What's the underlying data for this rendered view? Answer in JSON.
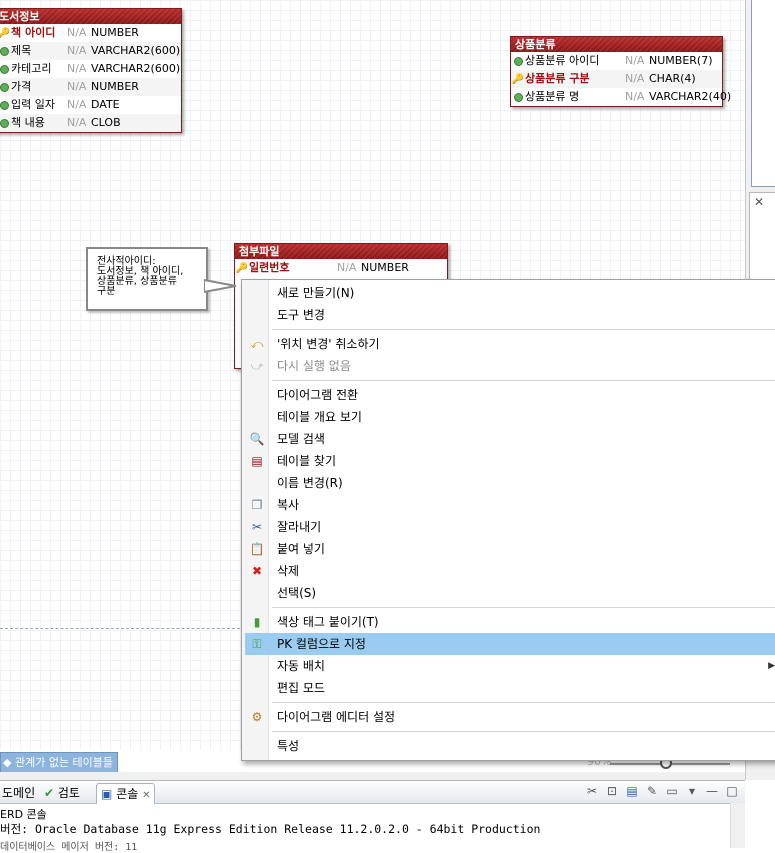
{
  "entities": {
    "book": {
      "title": "도서정보",
      "rows": [
        {
          "icon": "key",
          "name": "책 아이디",
          "pk": true,
          "na": "N/A",
          "type": "NUMBER"
        },
        {
          "icon": "dot",
          "name": "제목",
          "pk": false,
          "na": "N/A",
          "type": "VARCHAR2(600)"
        },
        {
          "icon": "dot",
          "name": "카테고리",
          "pk": false,
          "na": "N/A",
          "type": "VARCHAR2(600)"
        },
        {
          "icon": "dot",
          "name": "가격",
          "pk": false,
          "na": "N/A",
          "type": "NUMBER"
        },
        {
          "icon": "dot",
          "name": "입력 일자",
          "pk": false,
          "na": "N/A",
          "type": "DATE"
        },
        {
          "icon": "dot",
          "name": "책 내용",
          "pk": false,
          "na": "N/A",
          "type": "CLOB"
        }
      ]
    },
    "category": {
      "title": "상품분류",
      "rows": [
        {
          "icon": "dot",
          "name": "상품분류 아이디",
          "pk": false,
          "na": "N/A",
          "type": "NUMBER(7)"
        },
        {
          "icon": "key",
          "name": "상품분류 구분",
          "pk": true,
          "na": "N/A",
          "type": "CHAR(4)"
        },
        {
          "icon": "dot",
          "name": "상품분류 명",
          "pk": false,
          "na": "N/A",
          "type": "VARCHAR2(40)"
        }
      ]
    },
    "attach": {
      "title": "첨부파일",
      "rows": [
        {
          "icon": "key",
          "name": "일련번호",
          "pk": true,
          "na": "N/A",
          "type": "NUMBER"
        }
      ]
    }
  },
  "note": {
    "text": "전사적아이디:\n도서정보, 책 아이디,\n상품분류, 상품분류\n구분"
  },
  "canvas": {
    "untagged_label": "관계가 없는 테이블들",
    "zoom": "90%"
  },
  "context_menu": {
    "items": [
      {
        "label": "새로 만들기(N)",
        "icon": "",
        "disabled": false,
        "highlight": false,
        "submenu": false
      },
      {
        "label": "도구 변경",
        "icon": "",
        "disabled": false,
        "highlight": false,
        "submenu": false
      },
      {
        "sep": true
      },
      {
        "label": "'위치 변경' 취소하기",
        "icon": "undo",
        "disabled": false,
        "highlight": false,
        "submenu": false
      },
      {
        "label": "다시 실행 없음",
        "icon": "redo",
        "disabled": true,
        "highlight": false,
        "submenu": false
      },
      {
        "sep": true
      },
      {
        "label": "다이어그램 전환",
        "icon": "",
        "disabled": false,
        "highlight": false,
        "submenu": false
      },
      {
        "label": "테이블 개요 보기",
        "icon": "",
        "disabled": false,
        "highlight": false,
        "submenu": false
      },
      {
        "label": "모델 검색",
        "icon": "search",
        "disabled": false,
        "highlight": false,
        "submenu": false
      },
      {
        "label": "테이블 찾기",
        "icon": "table",
        "disabled": false,
        "highlight": false,
        "submenu": false
      },
      {
        "label": "이름 변경(R)",
        "icon": "",
        "disabled": false,
        "highlight": false,
        "submenu": false
      },
      {
        "label": "복사",
        "icon": "copy",
        "disabled": false,
        "highlight": false,
        "submenu": false
      },
      {
        "label": "잘라내기",
        "icon": "cut",
        "disabled": false,
        "highlight": false,
        "submenu": false
      },
      {
        "label": "붙여 넣기",
        "icon": "paste",
        "disabled": false,
        "highlight": false,
        "submenu": false
      },
      {
        "label": "삭제",
        "icon": "delete",
        "disabled": false,
        "highlight": false,
        "submenu": false
      },
      {
        "label": "선택(S)",
        "icon": "",
        "disabled": false,
        "highlight": false,
        "submenu": false
      },
      {
        "sep": true
      },
      {
        "label": "색상 태그 붙이기(T)",
        "icon": "tag",
        "disabled": false,
        "highlight": false,
        "submenu": false
      },
      {
        "label": "PK 컬럼으로 지정",
        "icon": "pk",
        "disabled": false,
        "highlight": true,
        "submenu": false
      },
      {
        "label": "자동 배치",
        "icon": "",
        "disabled": false,
        "highlight": false,
        "submenu": true
      },
      {
        "label": "편집 모드",
        "icon": "",
        "disabled": false,
        "highlight": false,
        "submenu": false
      },
      {
        "sep": true
      },
      {
        "label": "다이어그램 에디터 설정",
        "icon": "gear",
        "disabled": false,
        "highlight": false,
        "submenu": false
      },
      {
        "sep": true
      },
      {
        "label": "특성",
        "icon": "",
        "disabled": false,
        "highlight": false,
        "submenu": false
      }
    ]
  },
  "console": {
    "tabs": [
      {
        "label": "도메인",
        "icon": ""
      },
      {
        "label": "검토",
        "icon": "check"
      },
      {
        "label": "콘솔",
        "icon": "console",
        "close": "✕"
      }
    ],
    "section": "ERD 콘솔",
    "line1": "버전: Oracle Database 11g Express Edition Release 11.2.0.2.0 - 64bit Production",
    "line2": "데이터베이스 메이저 버전: 11"
  },
  "colors": {
    "entity_header": "#8a1515",
    "highlight": "#99ccf0",
    "untagged": "#8db4dc"
  }
}
